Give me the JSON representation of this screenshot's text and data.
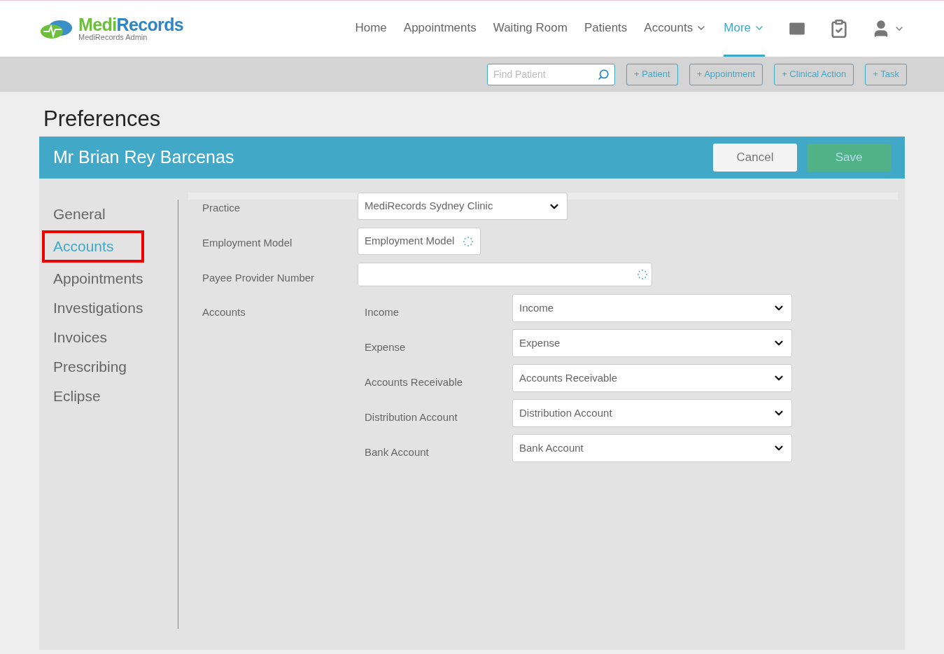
{
  "logo": {
    "name_part1": "Medi",
    "name_part2": "Records",
    "subtitle": "MediRecords Admin"
  },
  "nav": [
    {
      "label": "Home",
      "selected": false,
      "dropdown": false
    },
    {
      "label": "Appointments",
      "selected": false,
      "dropdown": false
    },
    {
      "label": "Waiting Room",
      "selected": false,
      "dropdown": false
    },
    {
      "label": "Patients",
      "selected": false,
      "dropdown": false
    },
    {
      "label": "Accounts",
      "selected": false,
      "dropdown": true
    },
    {
      "label": "More",
      "selected": true,
      "dropdown": true
    }
  ],
  "toolbar": {
    "search": {
      "placeholder": "Find Patient"
    },
    "buttons": [
      "+ Patient",
      "+ Appointment",
      "+ Clinical Action",
      "+ Task"
    ]
  },
  "page_title": "Preferences",
  "panel": {
    "title": "Mr Brian Rey Barcenas",
    "buttons": [
      {
        "label": "Cancel",
        "kind": "cancel",
        "disabled": false
      },
      {
        "label": "Save",
        "kind": "save",
        "disabled": true
      }
    ]
  },
  "sidebar": [
    {
      "label": "General",
      "selected": false,
      "highlighted": false
    },
    {
      "label": "Accounts",
      "selected": true,
      "highlighted": true
    },
    {
      "label": "Appointments",
      "selected": false,
      "highlighted": false
    },
    {
      "label": "Investigations",
      "selected": false,
      "highlighted": false
    },
    {
      "label": "Invoices",
      "selected": false,
      "highlighted": false
    },
    {
      "label": "Prescribing",
      "selected": false,
      "highlighted": false
    },
    {
      "label": "Eclipse",
      "selected": false,
      "highlighted": false
    }
  ],
  "form": [
    {
      "label": "Practice",
      "kind": "select",
      "value": "MediRecords Sydney Clinic"
    },
    {
      "label": "Employment Model",
      "kind": "loading-select",
      "value": "Employment Model"
    },
    {
      "label": "Payee Provider Number",
      "kind": "loading-input"
    }
  ],
  "accounts": {
    "label": "Accounts",
    "rows": [
      {
        "label": "Income",
        "value": "Income"
      },
      {
        "label": "Expense",
        "value": "Expense"
      },
      {
        "label": "Accounts Receivable",
        "value": "Accounts Receivable"
      },
      {
        "label": "Distribution Account",
        "value": "Distribution Account"
      },
      {
        "label": "Bank Account",
        "value": "Bank Account"
      }
    ]
  }
}
